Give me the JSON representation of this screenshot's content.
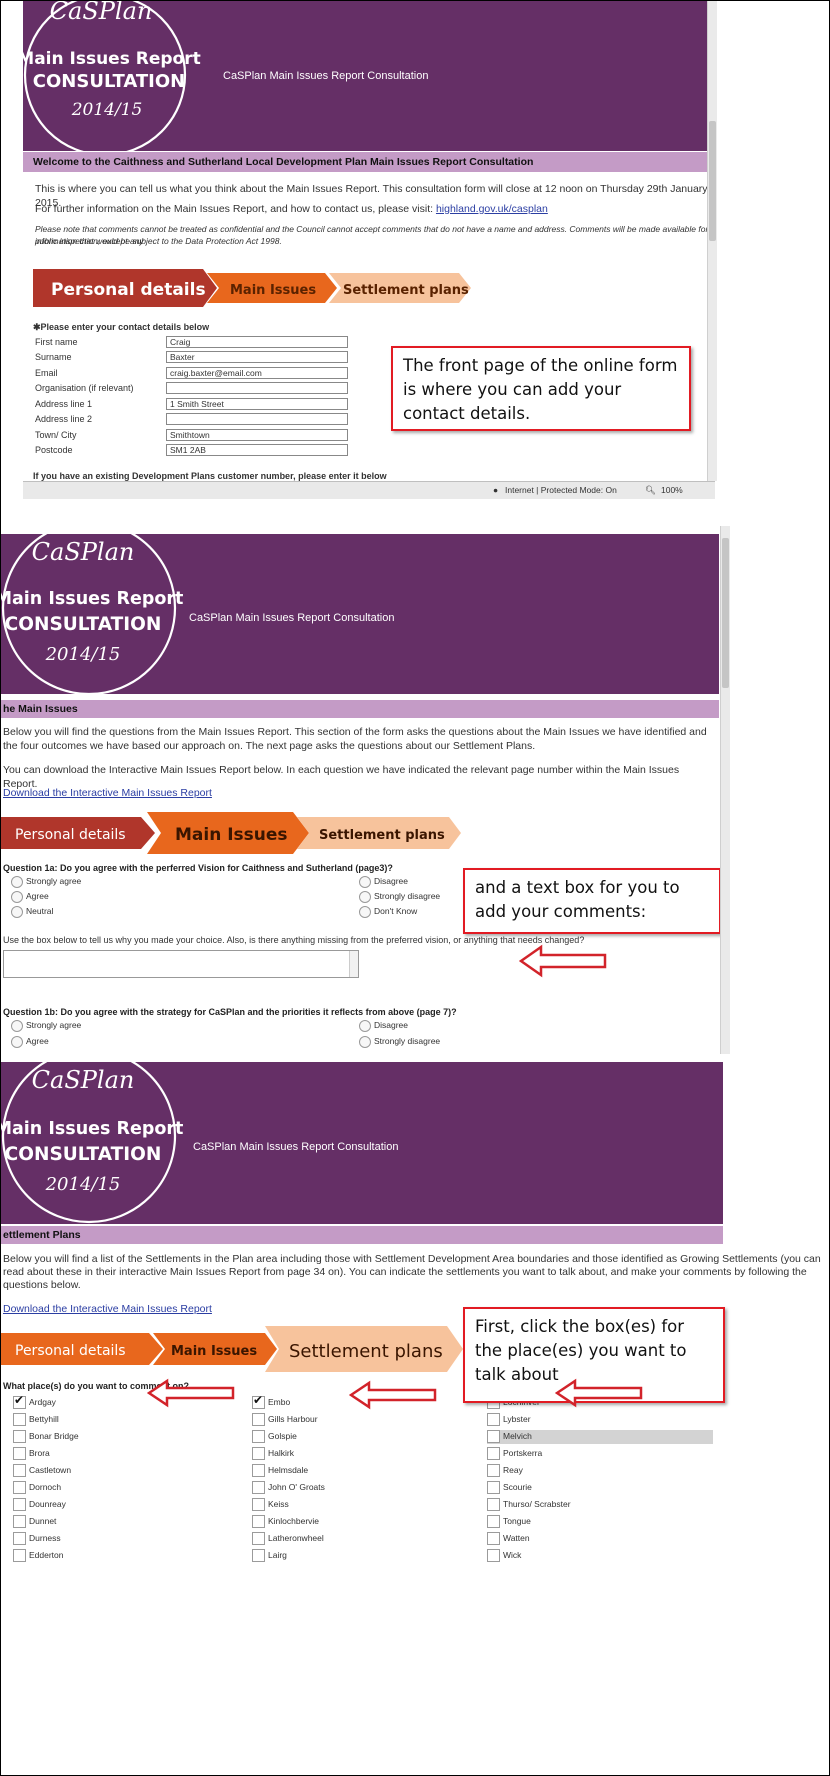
{
  "colors": {
    "banner_purple": "#652f66",
    "section_bar_lilac": "#c49bc6",
    "step_dark_red": "#b0362b",
    "step_orange": "#e8671d",
    "step_peach": "#f7c39c",
    "callout_red": "#e21b23"
  },
  "logo": {
    "script": "CaSPlan",
    "line1": "Main Issues Report",
    "line2": "CONSULTATION",
    "line3": "2014/15"
  },
  "banner_title": "CaSPlan Main Issues Report Consultation",
  "banner_title_alt": "CaSPlan Main Issues Report Consultation",
  "steps": {
    "personal": "Personal details",
    "issues": "Main Issues",
    "settlement": "Settlement plans"
  },
  "page1": {
    "section_title": "Welcome to the Caithness and Sutherland Local Development Plan Main Issues Report Consultation",
    "intro": "This is where you can tell us what you think about the Main Issues Report. This consultation form will close at 12 noon on Thursday 29th January 2015.",
    "info_prefix": "For further information on the Main Issues Report, and how to contact us, please visit: ",
    "info_link": "highland.gov.uk/casplan",
    "notice_line1": "Please note that comments cannot be treated as confidential and the Council cannot accept comments that do not have a name and address. Comments will be made available for public inspection, except any",
    "notice_line2": "information that would be subject to the Data Protection Act 1998.",
    "contact_heading": "Please enter your contact details below",
    "fields": [
      {
        "label": "First name",
        "value": "Craig"
      },
      {
        "label": "Surname",
        "value": "Baxter"
      },
      {
        "label": "Email",
        "value": "craig.baxter@email.com"
      },
      {
        "label": "Organisation (if relevant)",
        "value": ""
      },
      {
        "label": "Address line 1",
        "value": "1 Smith Street"
      },
      {
        "label": "Address line 2",
        "value": ""
      },
      {
        "label": "Town/ City",
        "value": "Smithtown"
      },
      {
        "label": "Postcode",
        "value": "SM1 2AB"
      }
    ],
    "customer_number_text": "If you have an existing Development Plans customer number, please enter it below",
    "callout": "The front page of the online form is where you can add your contact details.",
    "status_zone": "Internet | Protected Mode: On",
    "status_zoom": "100%"
  },
  "page2": {
    "section_title": "he Main Issues",
    "para1": "Below you will find the questions from the Main Issues Report. This section of the form asks the questions about the Main Issues we have identified and the four outcomes we have based our approach on. The next page asks the questions about our Settlement Plans.",
    "para2": "You can download the Interactive Main Issues Report below. In each question we have indicated the relevant page number within the Main Issues Report.",
    "download_link": "Download the Interactive Main Issues Report",
    "q1a": "Question 1a: Do you agree with the perferred Vision for Caithness and Sutherland (page3)?",
    "q1a_options_left": [
      "Strongly agree",
      "Agree",
      "Neutral"
    ],
    "q1a_options_right": [
      "Disagree",
      "Strongly disagree",
      "Don't Know"
    ],
    "textbox_prompt": "Use the box below to tell us why you made your choice. Also, is there anything missing from the preferred vision, or anything that needs changed?",
    "q1b": "Question 1b: Do you agree with the strategy for CaSPlan and the priorities it reflects from above (page 7)?",
    "q1b_options_left": [
      "Strongly agree",
      "Agree"
    ],
    "q1b_options_right": [
      "Disagree",
      "Strongly disagree"
    ],
    "callout": "and a text box for you to add your comments:"
  },
  "page3": {
    "section_title": "ettlement Plans",
    "para1_line1": "Below you will find a list of the Settlements in the Plan area including those with Settlement Development Area boundaries and those identified as Growing Settlements (you can",
    "para1_line2": "read about these in their interactive Main Issues Report from page 34 on). You can indicate the settlements you want to talk about, and make your comments by following the",
    "para1_line3": "questions below.",
    "download_link": "Download the Interactive Main Issues Report",
    "question": "What place(s) do you want to comment on?",
    "col1": [
      "Ardgay",
      "Bettyhill",
      "Bonar Bridge",
      "Brora",
      "Castletown",
      "Dornoch",
      "Dounreay",
      "Dunnet",
      "Durness",
      "Edderton"
    ],
    "col2": [
      "Embo",
      "Gills Harbour",
      "Golspie",
      "Halkirk",
      "Helmsdale",
      "John O' Groats",
      "Keiss",
      "Kinlochbervie",
      "Latheronwheel",
      "Lairg"
    ],
    "col3": [
      "Lochinver",
      "Lybster",
      "Melvich",
      "Portskerra",
      "Reay",
      "Scourie",
      "Thurso/ Scrabster",
      "Tongue",
      "Watten",
      "Wick"
    ],
    "checked": [
      "Ardgay",
      "Embo",
      "Lochinver"
    ],
    "callout": "First, click the box(es) for the place(es) you want to talk about"
  }
}
